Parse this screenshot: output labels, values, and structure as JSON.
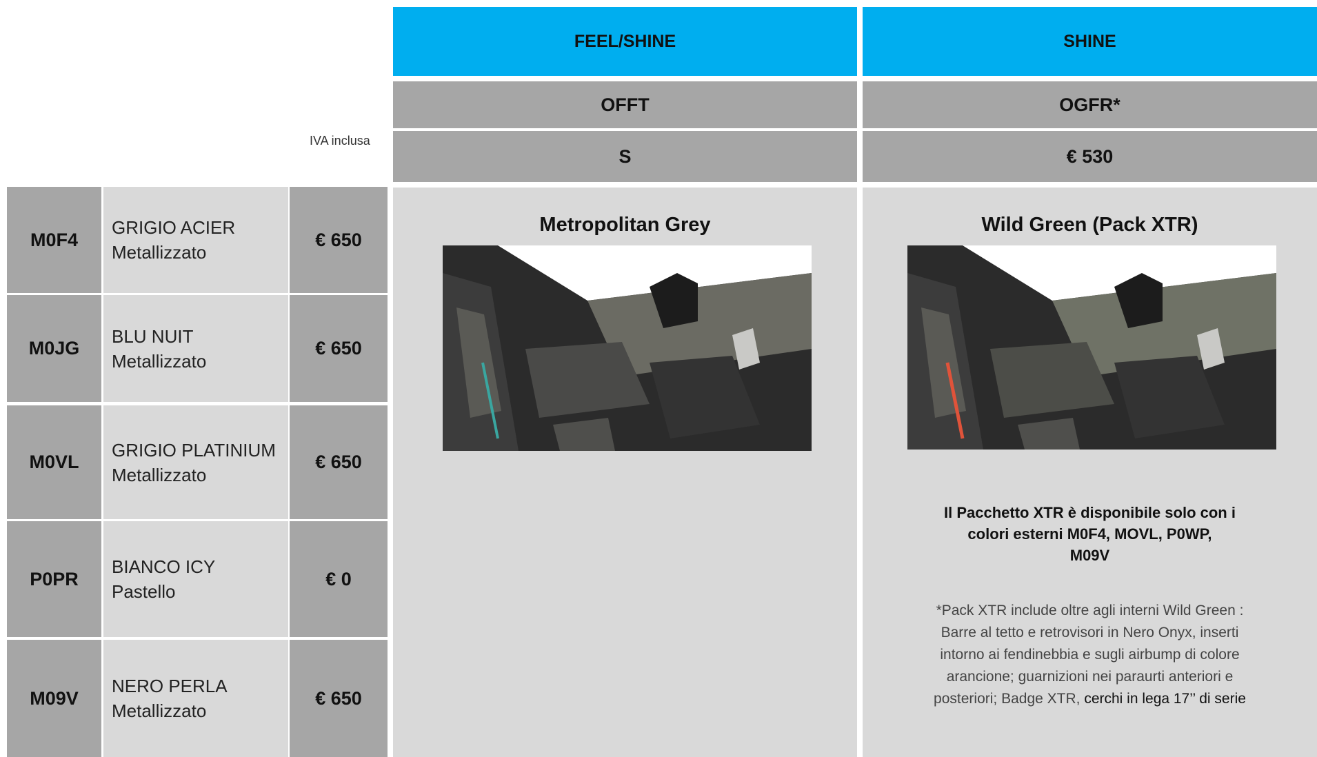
{
  "header": {
    "col1": {
      "trim": "FEEL/SHINE",
      "code": "OFFT",
      "price": "S"
    },
    "col2": {
      "trim": "SHINE",
      "code": "OGFR*",
      "price": "€ 530"
    }
  },
  "iva_label": "IVA inclusa",
  "colors": [
    {
      "code": "M0F4",
      "name": "GRIGIO ACIER",
      "finish": "Metallizzato",
      "price": "€ 650"
    },
    {
      "code": "M0JG",
      "name": "BLU NUIT",
      "finish": "Metallizzato",
      "price": "€ 650"
    },
    {
      "code": "M0VL",
      "name": "GRIGIO PLATINIUM",
      "finish": "Metallizzato",
      "price": "€ 650"
    },
    {
      "code": "P0PR",
      "name": "BIANCO ICY",
      "finish": "Pastello",
      "price": "€ 0"
    },
    {
      "code": "M09V",
      "name": "NERO PERLA",
      "finish": "Metallizzato",
      "price": "€ 650"
    }
  ],
  "interiors": [
    {
      "title": "Metropolitan Grey",
      "accent": "#3aa6a0"
    },
    {
      "title": "Wild Green (Pack XTR)",
      "accent": "#e0533a"
    }
  ],
  "notes": {
    "xtr_line1": "Il Pacchetto XTR è disponibile solo con i",
    "xtr_line2": "colori esterni M0F4, MOVL, P0WP,",
    "xtr_line3": "M09V",
    "pack_line1": "*Pack XTR include oltre agli interni Wild Green :",
    "pack_line2": "Barre al tetto e retrovisori in Nero Onyx, inserti",
    "pack_line3": "intorno ai fendinebbia e sugli airbump di colore",
    "pack_line4": "arancione; guarnizioni nei paraurti anteriori e",
    "pack_line5_a": "posteriori; Badge XTR, ",
    "pack_line5_b": "cerchi in lega 17’’ di serie"
  }
}
